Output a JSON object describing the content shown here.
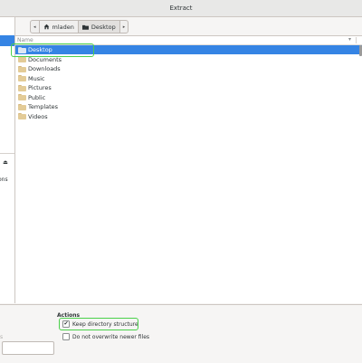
{
  "window": {
    "title": "Extract"
  },
  "pathbar": {
    "back_arrow": "◂",
    "crumbs": [
      {
        "label": "mladen",
        "icon": "home-icon"
      },
      {
        "label": "Desktop",
        "icon": "folder-icon"
      }
    ],
    "forward_arrow": "▸"
  },
  "list": {
    "column_name": "Name",
    "sort_indicator": "▾",
    "folders": [
      "Desktop",
      "Documents",
      "Downloads",
      "Music",
      "Pictures",
      "Public",
      "Templates",
      "Videos"
    ],
    "selected_index": 0
  },
  "sidebar": {
    "eject_glyph": "⏏",
    "partial_text": "ons"
  },
  "actions": {
    "title": "Actions",
    "keep_structure": {
      "label": "Keep directory structure",
      "checked": true
    },
    "no_overwrite": {
      "label": "Do not overwrite newer files",
      "checked": false
    }
  },
  "bottom_left": {
    "partial_label": "s"
  },
  "colors": {
    "accent": "#3584e4",
    "highlight": "#4ad14a"
  }
}
